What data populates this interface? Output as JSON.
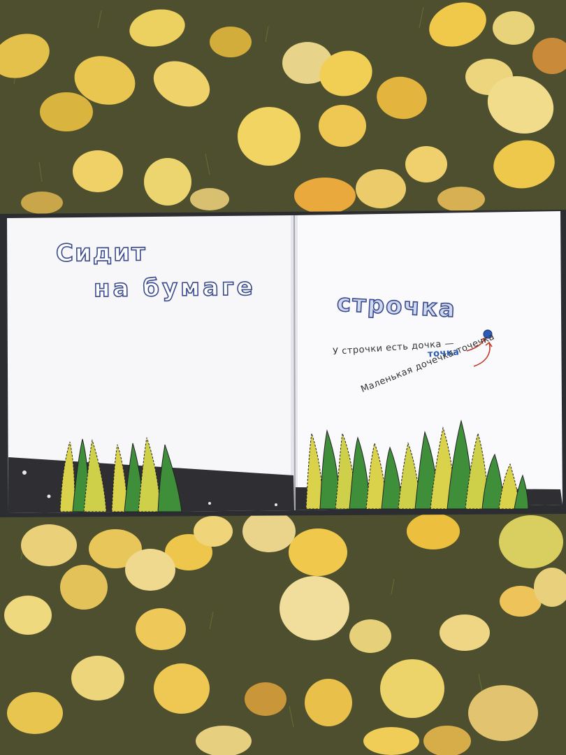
{
  "book": {
    "left_page": {
      "title_line_1": "Сидит",
      "title_line_2": "на бумаге"
    },
    "right_page": {
      "title_word": "строчка",
      "line_daughter": "У строчки есть дочка —",
      "word_dot": "точка",
      "line_small": "Маленькая дочечка-точечка"
    }
  },
  "colors": {
    "page": "#f7f7fa",
    "outline_text": "#3a4a8c",
    "accent_blue": "#2b5bb8",
    "arrow_red": "#c0392b",
    "grass_green": "#3f8f3a",
    "grass_yellow": "#d9d24a",
    "ground_dark": "#2f2f33",
    "leaf_yellow": "#e6c24a"
  }
}
